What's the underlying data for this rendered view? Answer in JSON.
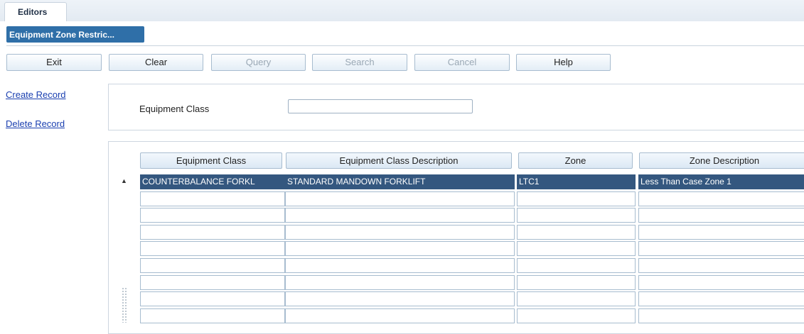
{
  "window": {
    "tab_label": "Editors"
  },
  "document_tab": {
    "label": "Equipment Zone Restric..."
  },
  "toolbar": {
    "exit": "Exit",
    "clear": "Clear",
    "query": "Query",
    "search": "Search",
    "cancel": "Cancel",
    "help": "Help"
  },
  "actions": {
    "create_record": "Create Record",
    "delete_record": "Delete Record"
  },
  "filter": {
    "equipment_class_label": "Equipment Class",
    "equipment_class_value": ""
  },
  "table": {
    "columns": [
      "Equipment Class",
      "Equipment Class Description",
      "Zone",
      "Zone Description"
    ],
    "rows": [
      [
        "COUNTERBALANCE FORKL",
        "STANDARD MANDOWN FORKLIFT",
        "LTC1",
        "Less Than Case Zone 1"
      ],
      [
        "",
        "",
        "",
        ""
      ],
      [
        "",
        "",
        "",
        ""
      ],
      [
        "",
        "",
        "",
        ""
      ],
      [
        "",
        "",
        "",
        ""
      ],
      [
        "",
        "",
        "",
        ""
      ],
      [
        "",
        "",
        "",
        ""
      ],
      [
        "",
        "",
        "",
        ""
      ],
      [
        "",
        "",
        "",
        ""
      ]
    ],
    "selected_row": 0
  },
  "colors": {
    "accent": "#2f6fa8",
    "selection": "#34577f",
    "link": "#1a3fb0"
  }
}
